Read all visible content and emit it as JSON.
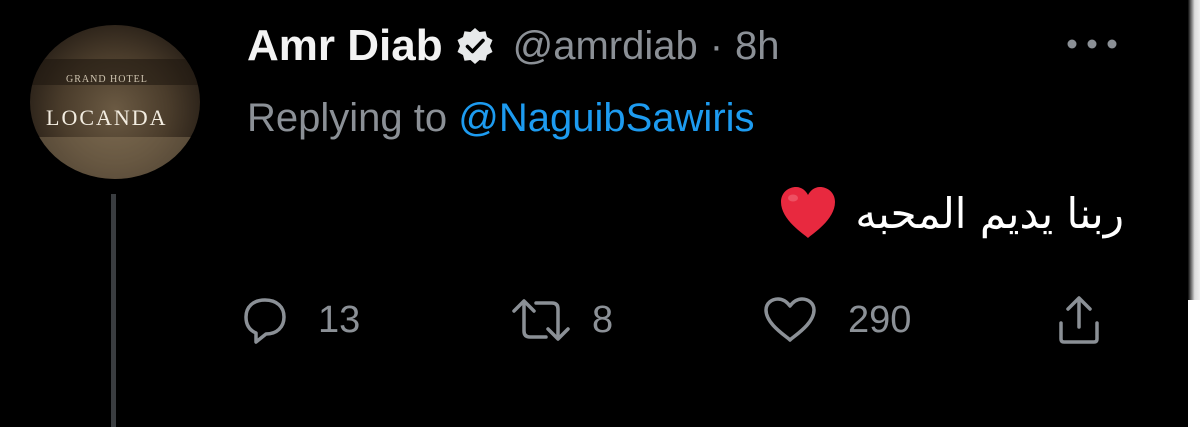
{
  "tweet": {
    "avatar": {
      "logo_small": "GRAND HOTEL",
      "logo_text": "LOCANDA"
    },
    "author": {
      "display_name": "Amr Diab",
      "handle": "@amrdiab",
      "separator": "·",
      "time": "8h"
    },
    "replying": {
      "prefix": "Replying to",
      "mention": "@NaguibSawiris"
    },
    "text": "ربنا يديم المحبه",
    "actions": {
      "reply_count": "13",
      "retweet_count": "8",
      "like_count": "290"
    }
  },
  "colors": {
    "background": "#000000",
    "muted": "#8b9096",
    "accent": "#1d9bf0",
    "heart": "#e8293f"
  },
  "icons": [
    "verified-badge-icon",
    "more-icon",
    "red-heart-emoji-icon",
    "reply-icon",
    "retweet-icon",
    "like-icon",
    "share-icon"
  ]
}
